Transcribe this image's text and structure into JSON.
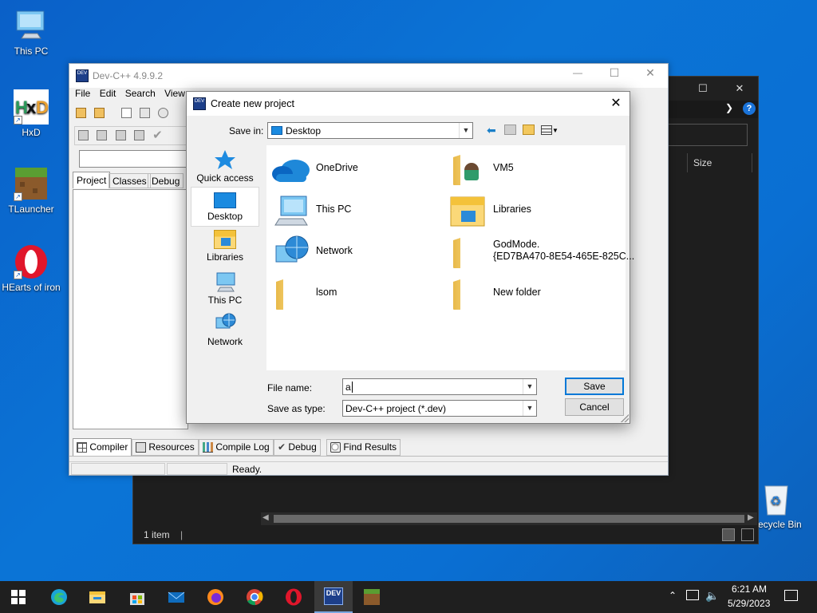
{
  "desktop": {
    "icons": [
      {
        "label": "This PC"
      },
      {
        "label": "HxD"
      },
      {
        "label": "TLauncher"
      },
      {
        "label": "HEarts of iron"
      },
      {
        "label": "Recycle Bin"
      }
    ]
  },
  "explorer": {
    "column_size": "Size",
    "status_count": "1 item"
  },
  "devcpp": {
    "title": "Dev-C++ 4.9.9.2",
    "menu": [
      "File",
      "Edit",
      "Search",
      "View"
    ],
    "left_tabs": [
      "Project",
      "Classes",
      "Debug"
    ],
    "bottom_tabs": [
      "Compiler",
      "Resources",
      "Compile Log",
      "Debug",
      "Find Results"
    ],
    "status": "Ready."
  },
  "dialog": {
    "title": "Create new project",
    "save_in_label": "Save in:",
    "save_in_value": "Desktop",
    "nav": [
      {
        "label": "Quick access",
        "icon": "quick-access-star-icon"
      },
      {
        "label": "Desktop",
        "icon": "desktop-icon",
        "selected": true
      },
      {
        "label": "Libraries",
        "icon": "libraries-icon"
      },
      {
        "label": "This PC",
        "icon": "this-pc-icon"
      },
      {
        "label": "Network",
        "icon": "network-icon"
      }
    ],
    "items": [
      {
        "label": "OneDrive",
        "icon": "onedrive-icon"
      },
      {
        "label": "VM5",
        "icon": "user-folder-icon"
      },
      {
        "label": "This PC",
        "icon": "this-pc-icon"
      },
      {
        "label": "Libraries",
        "icon": "libraries-icon"
      },
      {
        "label": "Network",
        "icon": "network-icon"
      },
      {
        "label": "GodMode.",
        "label2": "{ED7BA470-8E54-465E-825C...",
        "icon": "folder-icon"
      },
      {
        "label": "lsom",
        "icon": "folder-icon"
      },
      {
        "label": "New folder",
        "icon": "folder-icon"
      }
    ],
    "file_name_label": "File name:",
    "file_name_value": "a",
    "save_as_label": "Save as type:",
    "save_as_value": "Dev-C++ project (*.dev)",
    "save_button": "Save",
    "cancel_button": "Cancel"
  },
  "taskbar": {
    "time": "6:21 AM",
    "date": "5/29/2023",
    "dev_label": "DEV"
  }
}
